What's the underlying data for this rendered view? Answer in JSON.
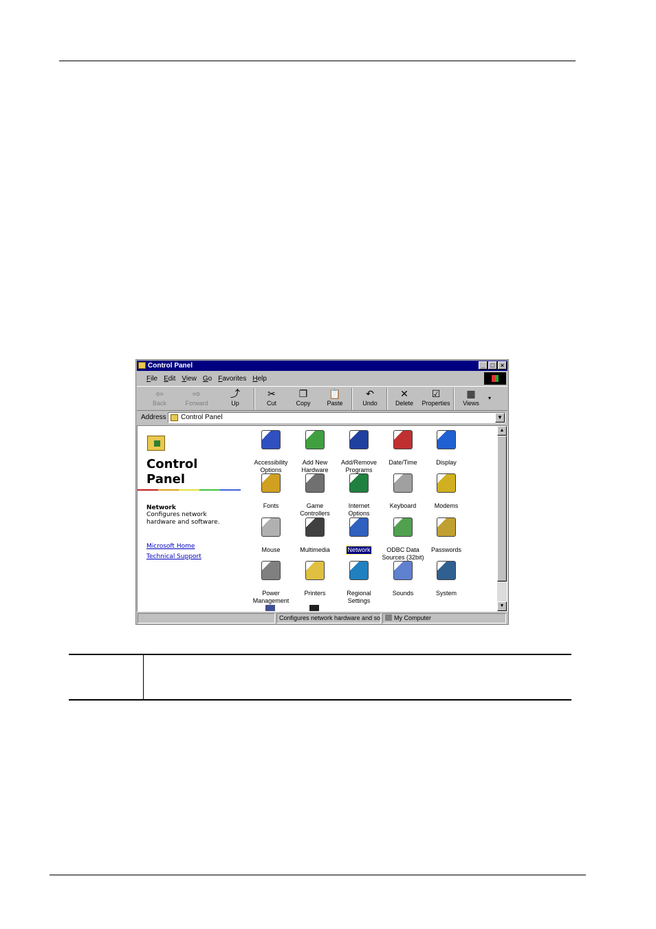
{
  "window": {
    "title": "Control Panel",
    "buttons": [
      "_",
      "□",
      "×"
    ]
  },
  "menu": [
    "File",
    "Edit",
    "View",
    "Go",
    "Favorites",
    "Help"
  ],
  "toolbar": {
    "back": "Back",
    "forward": "Forward",
    "up": "Up",
    "cut": "Cut",
    "copy": "Copy",
    "paste": "Paste",
    "undo": "Undo",
    "delete": "Delete",
    "properties": "Properties",
    "views": "Views"
  },
  "address": {
    "label": "Address",
    "value": "Control Panel"
  },
  "side": {
    "title_line1": "Control",
    "title_line2": "Panel",
    "selected_name": "Network",
    "selected_desc": "Configures network hardware and software.",
    "link1": "Microsoft Home",
    "link2": "Technical Support"
  },
  "icons": [
    {
      "label": "Accessibility\nOptions",
      "color": "#3050c0"
    },
    {
      "label": "Add New\nHardware",
      "color": "#40a040"
    },
    {
      "label": "Add/Remove\nPrograms",
      "color": "#2040a0"
    },
    {
      "label": "Date/Time",
      "color": "#c03030"
    },
    {
      "label": "Display",
      "color": "#2060d0"
    },
    {
      "label": "Fonts",
      "color": "#d0a020"
    },
    {
      "label": "Game\nControllers",
      "color": "#707070"
    },
    {
      "label": "Internet\nOptions",
      "color": "#208040"
    },
    {
      "label": "Keyboard",
      "color": "#a0a0a0"
    },
    {
      "label": "Modems",
      "color": "#d0b020"
    },
    {
      "label": "Mouse",
      "color": "#b0b0b0"
    },
    {
      "label": "Multimedia",
      "color": "#404040"
    },
    {
      "label": "Network",
      "color": "#3060c0"
    },
    {
      "label": "ODBC Data\nSources (32bit)",
      "color": "#50a050"
    },
    {
      "label": "Passwords",
      "color": "#c0a030"
    },
    {
      "label": "Power\nManagement",
      "color": "#808080"
    },
    {
      "label": "Printers",
      "color": "#e0c040"
    },
    {
      "label": "Regional\nSettings",
      "color": "#2080c0"
    },
    {
      "label": "Sounds",
      "color": "#6080d0"
    },
    {
      "label": "System",
      "color": "#306090"
    }
  ],
  "status": {
    "message": "Configures network hardware and sol",
    "zone": "My Computer"
  }
}
